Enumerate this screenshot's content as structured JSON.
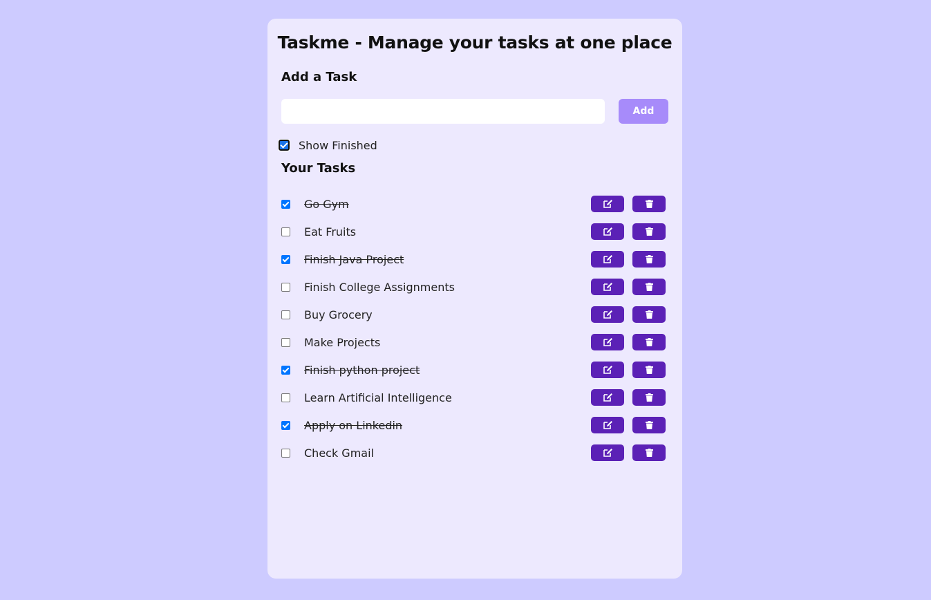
{
  "app": {
    "title": "Taskme - Manage your tasks at one place"
  },
  "add_section": {
    "heading": "Add a Task",
    "input_value": "",
    "input_placeholder": "",
    "add_label": "Add"
  },
  "filter": {
    "label": "Show Finished",
    "checked": true
  },
  "tasks_section": {
    "heading": "Your Tasks"
  },
  "tasks": [
    {
      "text": "Go Gym",
      "done": true
    },
    {
      "text": "Eat Fruits",
      "done": false
    },
    {
      "text": "Finish Java Project",
      "done": true
    },
    {
      "text": "Finish College Assignments",
      "done": false
    },
    {
      "text": "Buy Grocery",
      "done": false
    },
    {
      "text": "Make Projects",
      "done": false
    },
    {
      "text": "Finish python project",
      "done": true
    },
    {
      "text": "Learn Artificial Intelligence",
      "done": false
    },
    {
      "text": "Apply on Linkedin",
      "done": true
    },
    {
      "text": "Check Gmail",
      "done": false
    }
  ],
  "icons": {
    "edit": "edit-icon",
    "delete": "trash-icon"
  },
  "colors": {
    "page_background": "#cdcbff",
    "card_background": "#ede9fe",
    "add_button": "#a78bfa",
    "action_button": "#5b21b6",
    "checkbox_checked": "#0075ff"
  }
}
